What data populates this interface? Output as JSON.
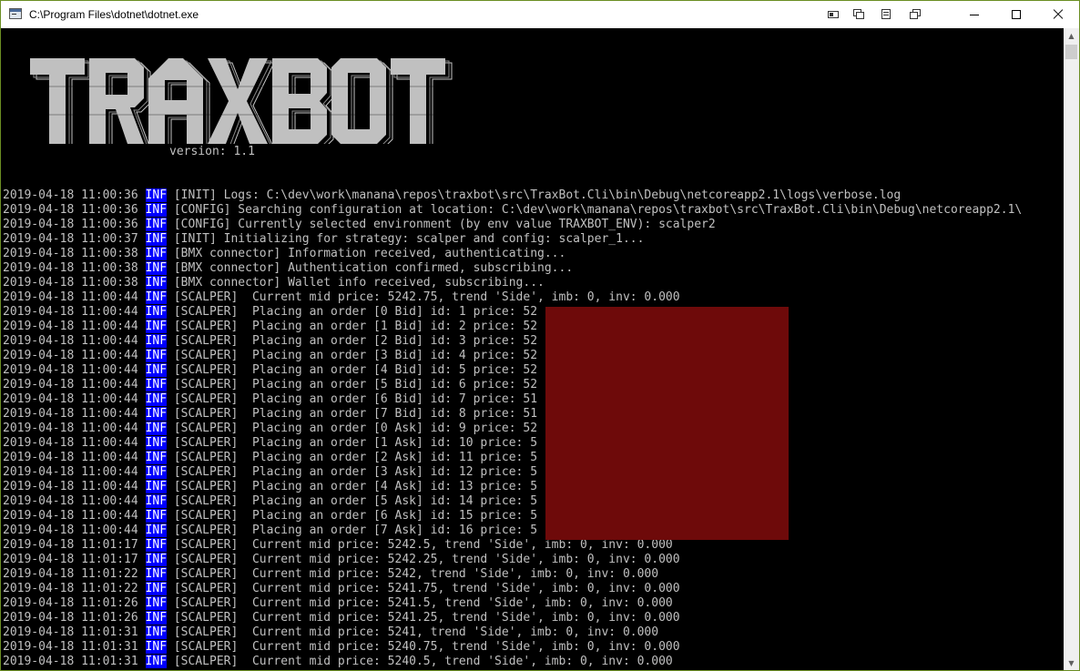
{
  "window": {
    "title": "C:\\Program Files\\dotnet\\dotnet.exe",
    "icons": [
      "console-app-icon",
      "tiled-window-icon",
      "windows-icon",
      "menu-icon",
      "restore-windows-icon",
      "minimize-icon",
      "maximize-icon",
      "close-icon"
    ]
  },
  "banner": {
    "logo_text": "TRAXBOT",
    "version": "version: 1.1"
  },
  "log": {
    "level": "INF",
    "lines": [
      {
        "ts": "2019-04-18 11:00:36",
        "msg": "[INIT] Logs: C:\\dev\\work\\manana\\repos\\traxbot\\src\\TraxBot.Cli\\bin\\Debug\\netcoreapp2.1\\logs\\verbose.log"
      },
      {
        "ts": "2019-04-18 11:00:36",
        "msg": "[CONFIG] Searching configuration at location: C:\\dev\\work\\manana\\repos\\traxbot\\src\\TraxBot.Cli\\bin\\Debug\\netcoreapp2.1\\"
      },
      {
        "ts": "2019-04-18 11:00:36",
        "msg": "[CONFIG] Currently selected environment (by env value TRAXBOT_ENV): scalper2"
      },
      {
        "ts": "2019-04-18 11:00:37",
        "msg": "[INIT] Initializing for strategy: scalper and config: scalper_1..."
      },
      {
        "ts": "2019-04-18 11:00:38",
        "msg": "[BMX connector] Information received, authenticating..."
      },
      {
        "ts": "2019-04-18 11:00:38",
        "msg": "[BMX connector] Authentication confirmed, subscribing..."
      },
      {
        "ts": "2019-04-18 11:00:38",
        "msg": "[BMX connector] Wallet info received, subscribing..."
      },
      {
        "ts": "2019-04-18 11:00:44",
        "msg": "[SCALPER]  Current mid price: 5242.75, trend 'Side', imb: 0, inv: 0.000"
      },
      {
        "ts": "2019-04-18 11:00:44",
        "msg": "[SCALPER]  Placing an order [0 Bid] id: 1 price: 52"
      },
      {
        "ts": "2019-04-18 11:00:44",
        "msg": "[SCALPER]  Placing an order [1 Bid] id: 2 price: 52"
      },
      {
        "ts": "2019-04-18 11:00:44",
        "msg": "[SCALPER]  Placing an order [2 Bid] id: 3 price: 52"
      },
      {
        "ts": "2019-04-18 11:00:44",
        "msg": "[SCALPER]  Placing an order [3 Bid] id: 4 price: 52"
      },
      {
        "ts": "2019-04-18 11:00:44",
        "msg": "[SCALPER]  Placing an order [4 Bid] id: 5 price: 52"
      },
      {
        "ts": "2019-04-18 11:00:44",
        "msg": "[SCALPER]  Placing an order [5 Bid] id: 6 price: 52"
      },
      {
        "ts": "2019-04-18 11:00:44",
        "msg": "[SCALPER]  Placing an order [6 Bid] id: 7 price: 51"
      },
      {
        "ts": "2019-04-18 11:00:44",
        "msg": "[SCALPER]  Placing an order [7 Bid] id: 8 price: 51"
      },
      {
        "ts": "2019-04-18 11:00:44",
        "msg": "[SCALPER]  Placing an order [0 Ask] id: 9 price: 52"
      },
      {
        "ts": "2019-04-18 11:00:44",
        "msg": "[SCALPER]  Placing an order [1 Ask] id: 10 price: 5"
      },
      {
        "ts": "2019-04-18 11:00:44",
        "msg": "[SCALPER]  Placing an order [2 Ask] id: 11 price: 5"
      },
      {
        "ts": "2019-04-18 11:00:44",
        "msg": "[SCALPER]  Placing an order [3 Ask] id: 12 price: 5"
      },
      {
        "ts": "2019-04-18 11:00:44",
        "msg": "[SCALPER]  Placing an order [4 Ask] id: 13 price: 5"
      },
      {
        "ts": "2019-04-18 11:00:44",
        "msg": "[SCALPER]  Placing an order [5 Ask] id: 14 price: 5"
      },
      {
        "ts": "2019-04-18 11:00:44",
        "msg": "[SCALPER]  Placing an order [6 Ask] id: 15 price: 5"
      },
      {
        "ts": "2019-04-18 11:00:44",
        "msg": "[SCALPER]  Placing an order [7 Ask] id: 16 price: 5"
      },
      {
        "ts": "2019-04-18 11:01:17",
        "msg": "[SCALPER]  Current mid price: 5242.5, trend 'Side', imb: 0, inv: 0.000"
      },
      {
        "ts": "2019-04-18 11:01:17",
        "msg": "[SCALPER]  Current mid price: 5242.25, trend 'Side', imb: 0, inv: 0.000"
      },
      {
        "ts": "2019-04-18 11:01:22",
        "msg": "[SCALPER]  Current mid price: 5242, trend 'Side', imb: 0, inv: 0.000"
      },
      {
        "ts": "2019-04-18 11:01:22",
        "msg": "[SCALPER]  Current mid price: 5241.75, trend 'Side', imb: 0, inv: 0.000"
      },
      {
        "ts": "2019-04-18 11:01:26",
        "msg": "[SCALPER]  Current mid price: 5241.5, trend 'Side', imb: 0, inv: 0.000"
      },
      {
        "ts": "2019-04-18 11:01:26",
        "msg": "[SCALPER]  Current mid price: 5241.25, trend 'Side', imb: 0, inv: 0.000"
      },
      {
        "ts": "2019-04-18 11:01:31",
        "msg": "[SCALPER]  Current mid price: 5241, trend 'Side', imb: 0, inv: 0.000"
      },
      {
        "ts": "2019-04-18 11:01:31",
        "msg": "[SCALPER]  Current mid price: 5240.75, trend 'Side', imb: 0, inv: 0.000"
      },
      {
        "ts": "2019-04-18 11:01:31",
        "msg": "[SCALPER]  Current mid price: 5240.5, trend 'Side', imb: 0, inv: 0.000"
      }
    ]
  },
  "colors": {
    "console_bg": "#000000",
    "text": "#c0c0c0",
    "level_bg": "#0000ff",
    "level_fg": "#ffffff",
    "redaction": "#6e0a0a",
    "window_border": "#6b8e23"
  }
}
